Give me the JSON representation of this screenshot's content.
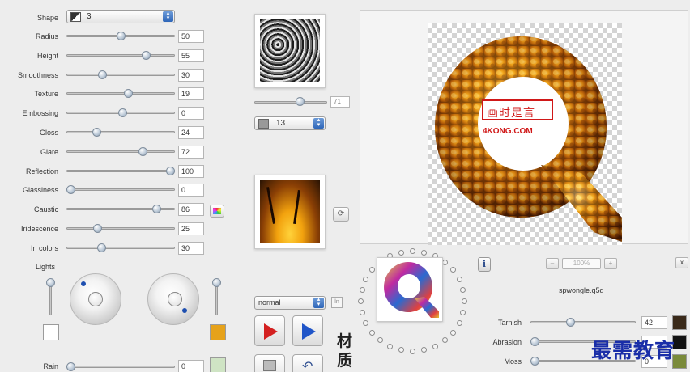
{
  "shape": {
    "label": "Shape",
    "value": "3"
  },
  "sliders": [
    {
      "label": "Radius",
      "value": "50",
      "level": 0.5
    },
    {
      "label": "Height",
      "value": "55",
      "level": 0.76
    },
    {
      "label": "Smoothness",
      "value": "30",
      "level": 0.32
    },
    {
      "label": "Texture",
      "value": "19",
      "level": 0.58
    },
    {
      "label": "Embossing",
      "value": "0",
      "level": 0.52
    },
    {
      "label": "Gloss",
      "value": "24",
      "level": 0.26
    },
    {
      "label": "Glare",
      "value": "72",
      "level": 0.72
    },
    {
      "label": "Reflection",
      "value": "100",
      "level": 1.0
    },
    {
      "label": "Glassiness",
      "value": "0",
      "level": 0.0
    },
    {
      "label": "Caustic",
      "value": "86",
      "level": 0.86
    },
    {
      "label": "Iridescence",
      "value": "25",
      "level": 0.27
    },
    {
      "label": "Iri colors",
      "value": "30",
      "level": 0.31
    }
  ],
  "lights": {
    "label": "Lights"
  },
  "rain": {
    "label": "Rain",
    "value": "0",
    "level": 0.0
  },
  "texture_panel": {
    "scale_value": "71",
    "scale_level": 0.65,
    "preset_value": "13"
  },
  "blend": {
    "value": "normal",
    "button_label": "ln"
  },
  "chinese_label": "材质",
  "preview": {
    "zoom": "100%",
    "zoom_out": "–",
    "zoom_in": "+",
    "expand": "x",
    "info": "i",
    "filename": "spwongle.q5q",
    "watermark_logo": "画时是言",
    "watermark_text": "4KONG.COM"
  },
  "bottom_sliders": [
    {
      "label": "Tarnish",
      "value": "42",
      "level": 0.37,
      "swatch": "#3a2a1a"
    },
    {
      "label": "Abrasion",
      "value": "",
      "level": 0.0,
      "swatch": "#111111"
    },
    {
      "label": "Moss",
      "value": "0",
      "level": 0.0,
      "swatch": "#7a8a3a"
    }
  ],
  "brand_overlay": "最需教育",
  "colors": {
    "accent": "#2e66b8",
    "gold_swatch": "#e6a21a",
    "white_swatch": "#ffffff",
    "rain_swatch": "#cfe4c4"
  }
}
